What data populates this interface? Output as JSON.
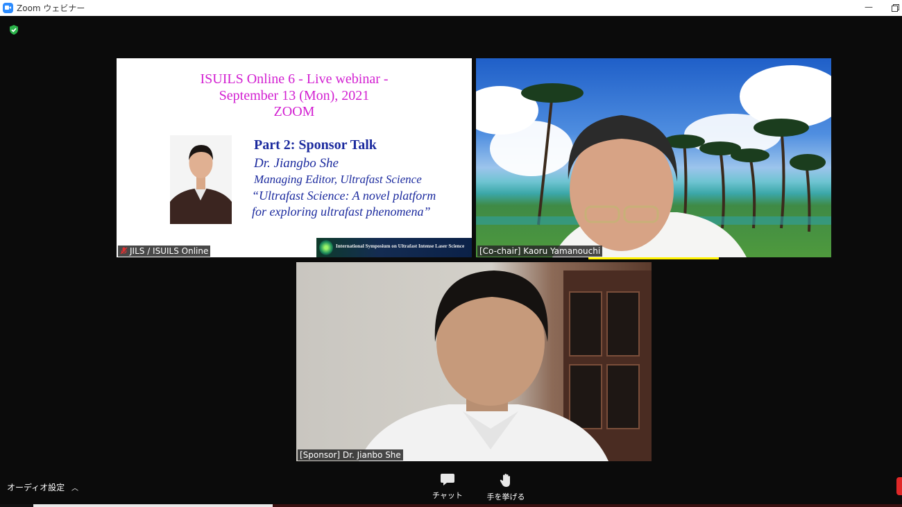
{
  "window": {
    "title": "Zoom ウェビナー"
  },
  "slide": {
    "title_lines": [
      "ISUILS Online 6 - Live webinar -",
      "September 13 (Mon), 2021",
      "ZOOM"
    ],
    "part": "Part 2: Sponsor Talk",
    "speaker": "Dr. Jiangbo She",
    "role": "Managing Editor, Ultrafast Science",
    "talk_lines": [
      "“Ultrafast Science: A novel platform",
      "for exploring ultrafast phenomena”"
    ],
    "banner": "International Symposium on Ultrafast Intense Laser Science"
  },
  "participants": [
    {
      "name": "JILS / ISUILS Online",
      "muted": true
    },
    {
      "name": "[Co-chair] Kaoru Yamanouchi",
      "active_speaker": true
    },
    {
      "name": "[Sponsor] Dr. Jianbo She"
    }
  ],
  "toolbar": {
    "audio_settings": "オーディオ設定",
    "chat": "チャット",
    "raise_hand": "手を挙げる"
  },
  "colors": {
    "accent": "#2d8cff",
    "slide_title": "#d21fd1",
    "slide_text": "#1b2a9e",
    "active_speaker": "#fff200"
  }
}
